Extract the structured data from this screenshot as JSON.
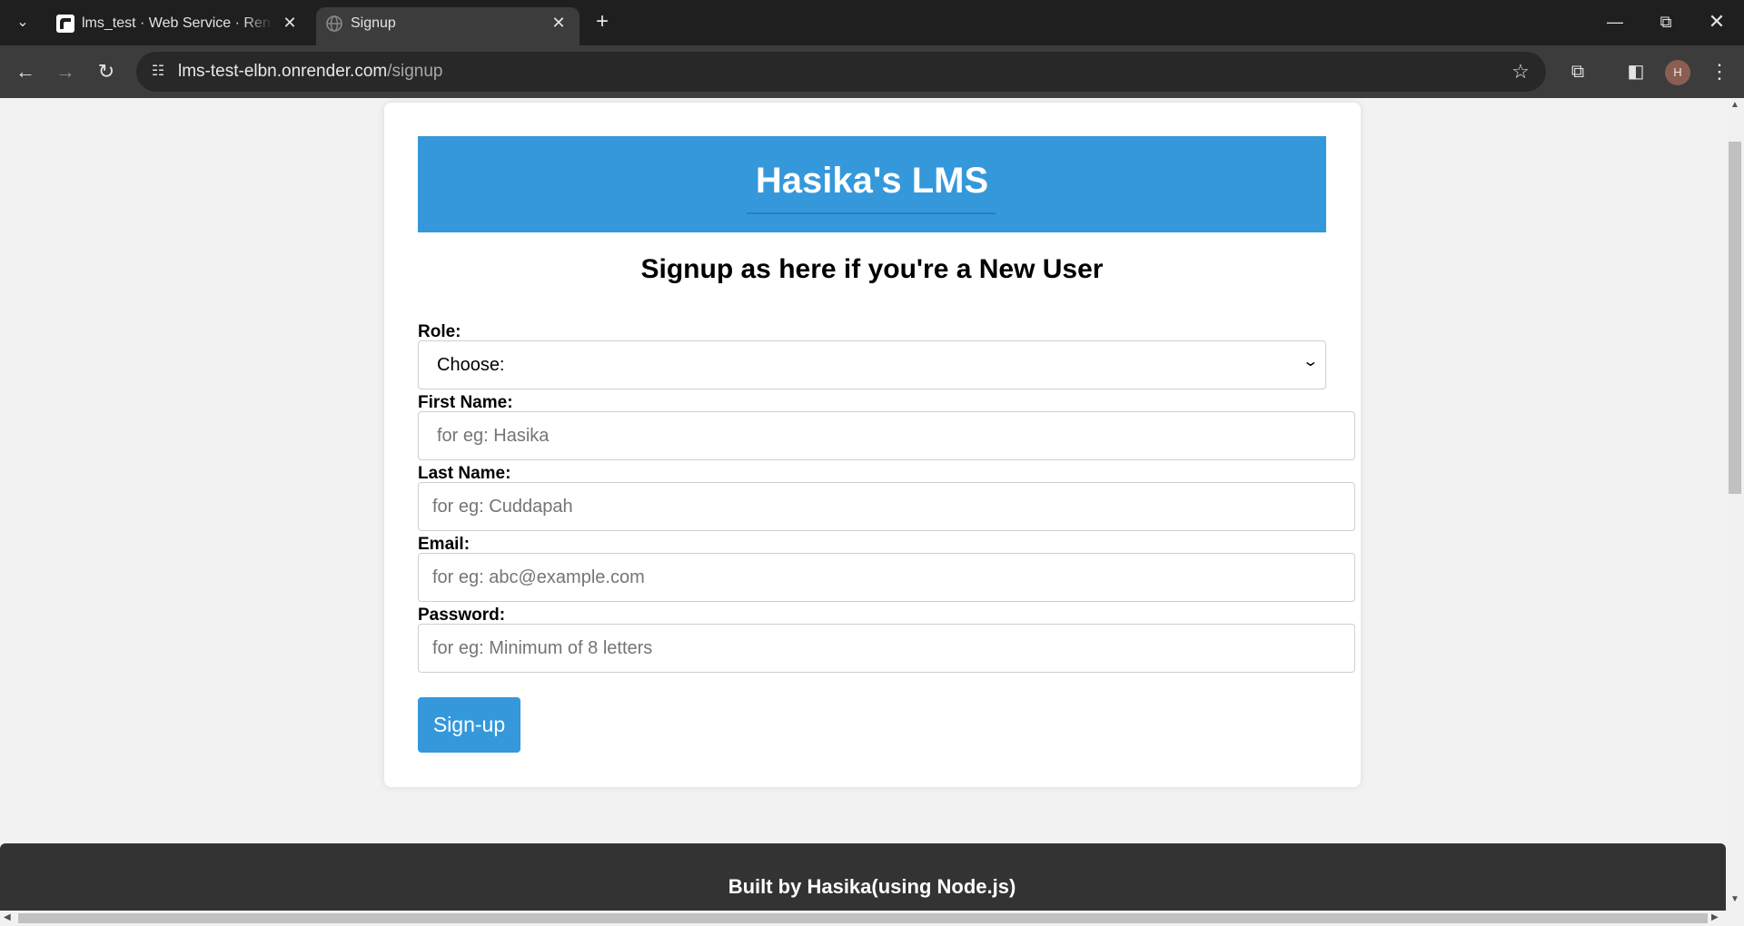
{
  "browser": {
    "tabs": [
      {
        "title": "lms_test · Web Service · Render",
        "favicon": "render-logo-icon",
        "active": false
      },
      {
        "title": "Signup",
        "favicon": "globe-icon",
        "active": true
      }
    ],
    "url_host": "lms-test-elbn.onrender.com",
    "url_path": "/signup",
    "profile_initial": "H",
    "colors": {
      "tabbar": "#1f1f1f",
      "toolbar": "#3c3c3c",
      "omnibox": "#282828"
    }
  },
  "page": {
    "banner_title": "Hasika's LMS",
    "subtitle": "Signup as here if you're a New User",
    "form": {
      "role_label": "Role:",
      "role_selected": "Choose:",
      "first_name_label": "First Name:",
      "first_name_placeholder": "for eg: Hasika",
      "last_name_label": "Last Name:",
      "last_name_placeholder": "for eg: Cuddapah",
      "email_label": "Email:",
      "email_placeholder": "for eg: abc@example.com",
      "password_label": "Password:",
      "password_placeholder": "for eg: Minimum of 8 letters",
      "submit_label": "Sign-up"
    },
    "footer_text": "Built by Hasika(using Node.js)",
    "colors": {
      "accent": "#3498db",
      "footer": "#333333",
      "background": "#f2f2f2"
    }
  }
}
